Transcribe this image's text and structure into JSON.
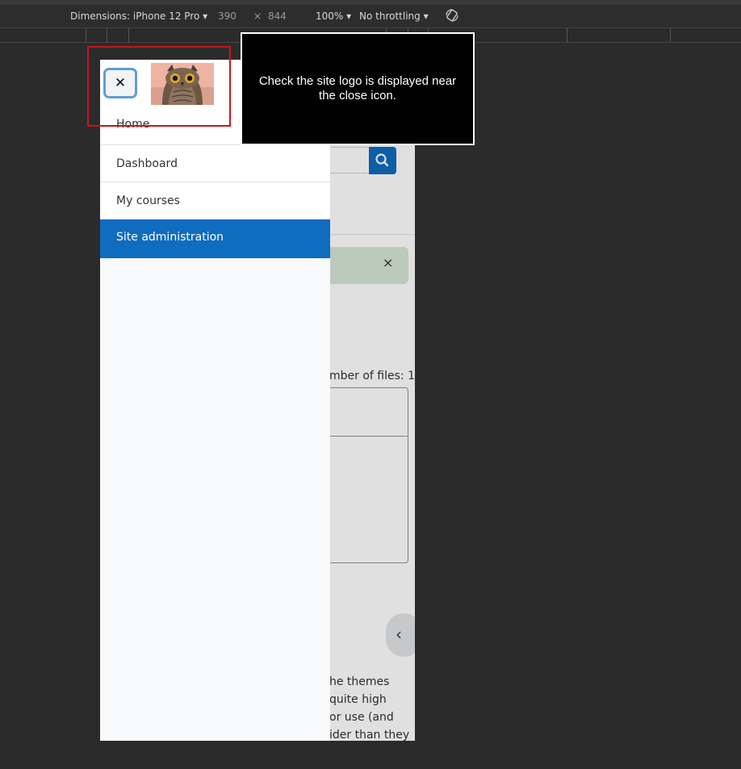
{
  "devtools": {
    "dimensions_label": "Dimensions: iPhone 12 Pro",
    "width": "390",
    "times": "×",
    "height": "844",
    "zoom": "100%",
    "throttling": "No throttling"
  },
  "drawer": {
    "close_symbol": "✕",
    "nav_items": [
      "Home",
      "Dashboard",
      "My courses",
      "Site administration"
    ]
  },
  "background": {
    "alert_close": "×",
    "files_text": "mber of files: 1",
    "drawer_toggle": "‹",
    "paragraph_lines": [
      "he themes",
      "quite high",
      "or use (and",
      "ider than they"
    ]
  },
  "tooltip": {
    "text": "Check the site logo is displayed near the close icon."
  }
}
